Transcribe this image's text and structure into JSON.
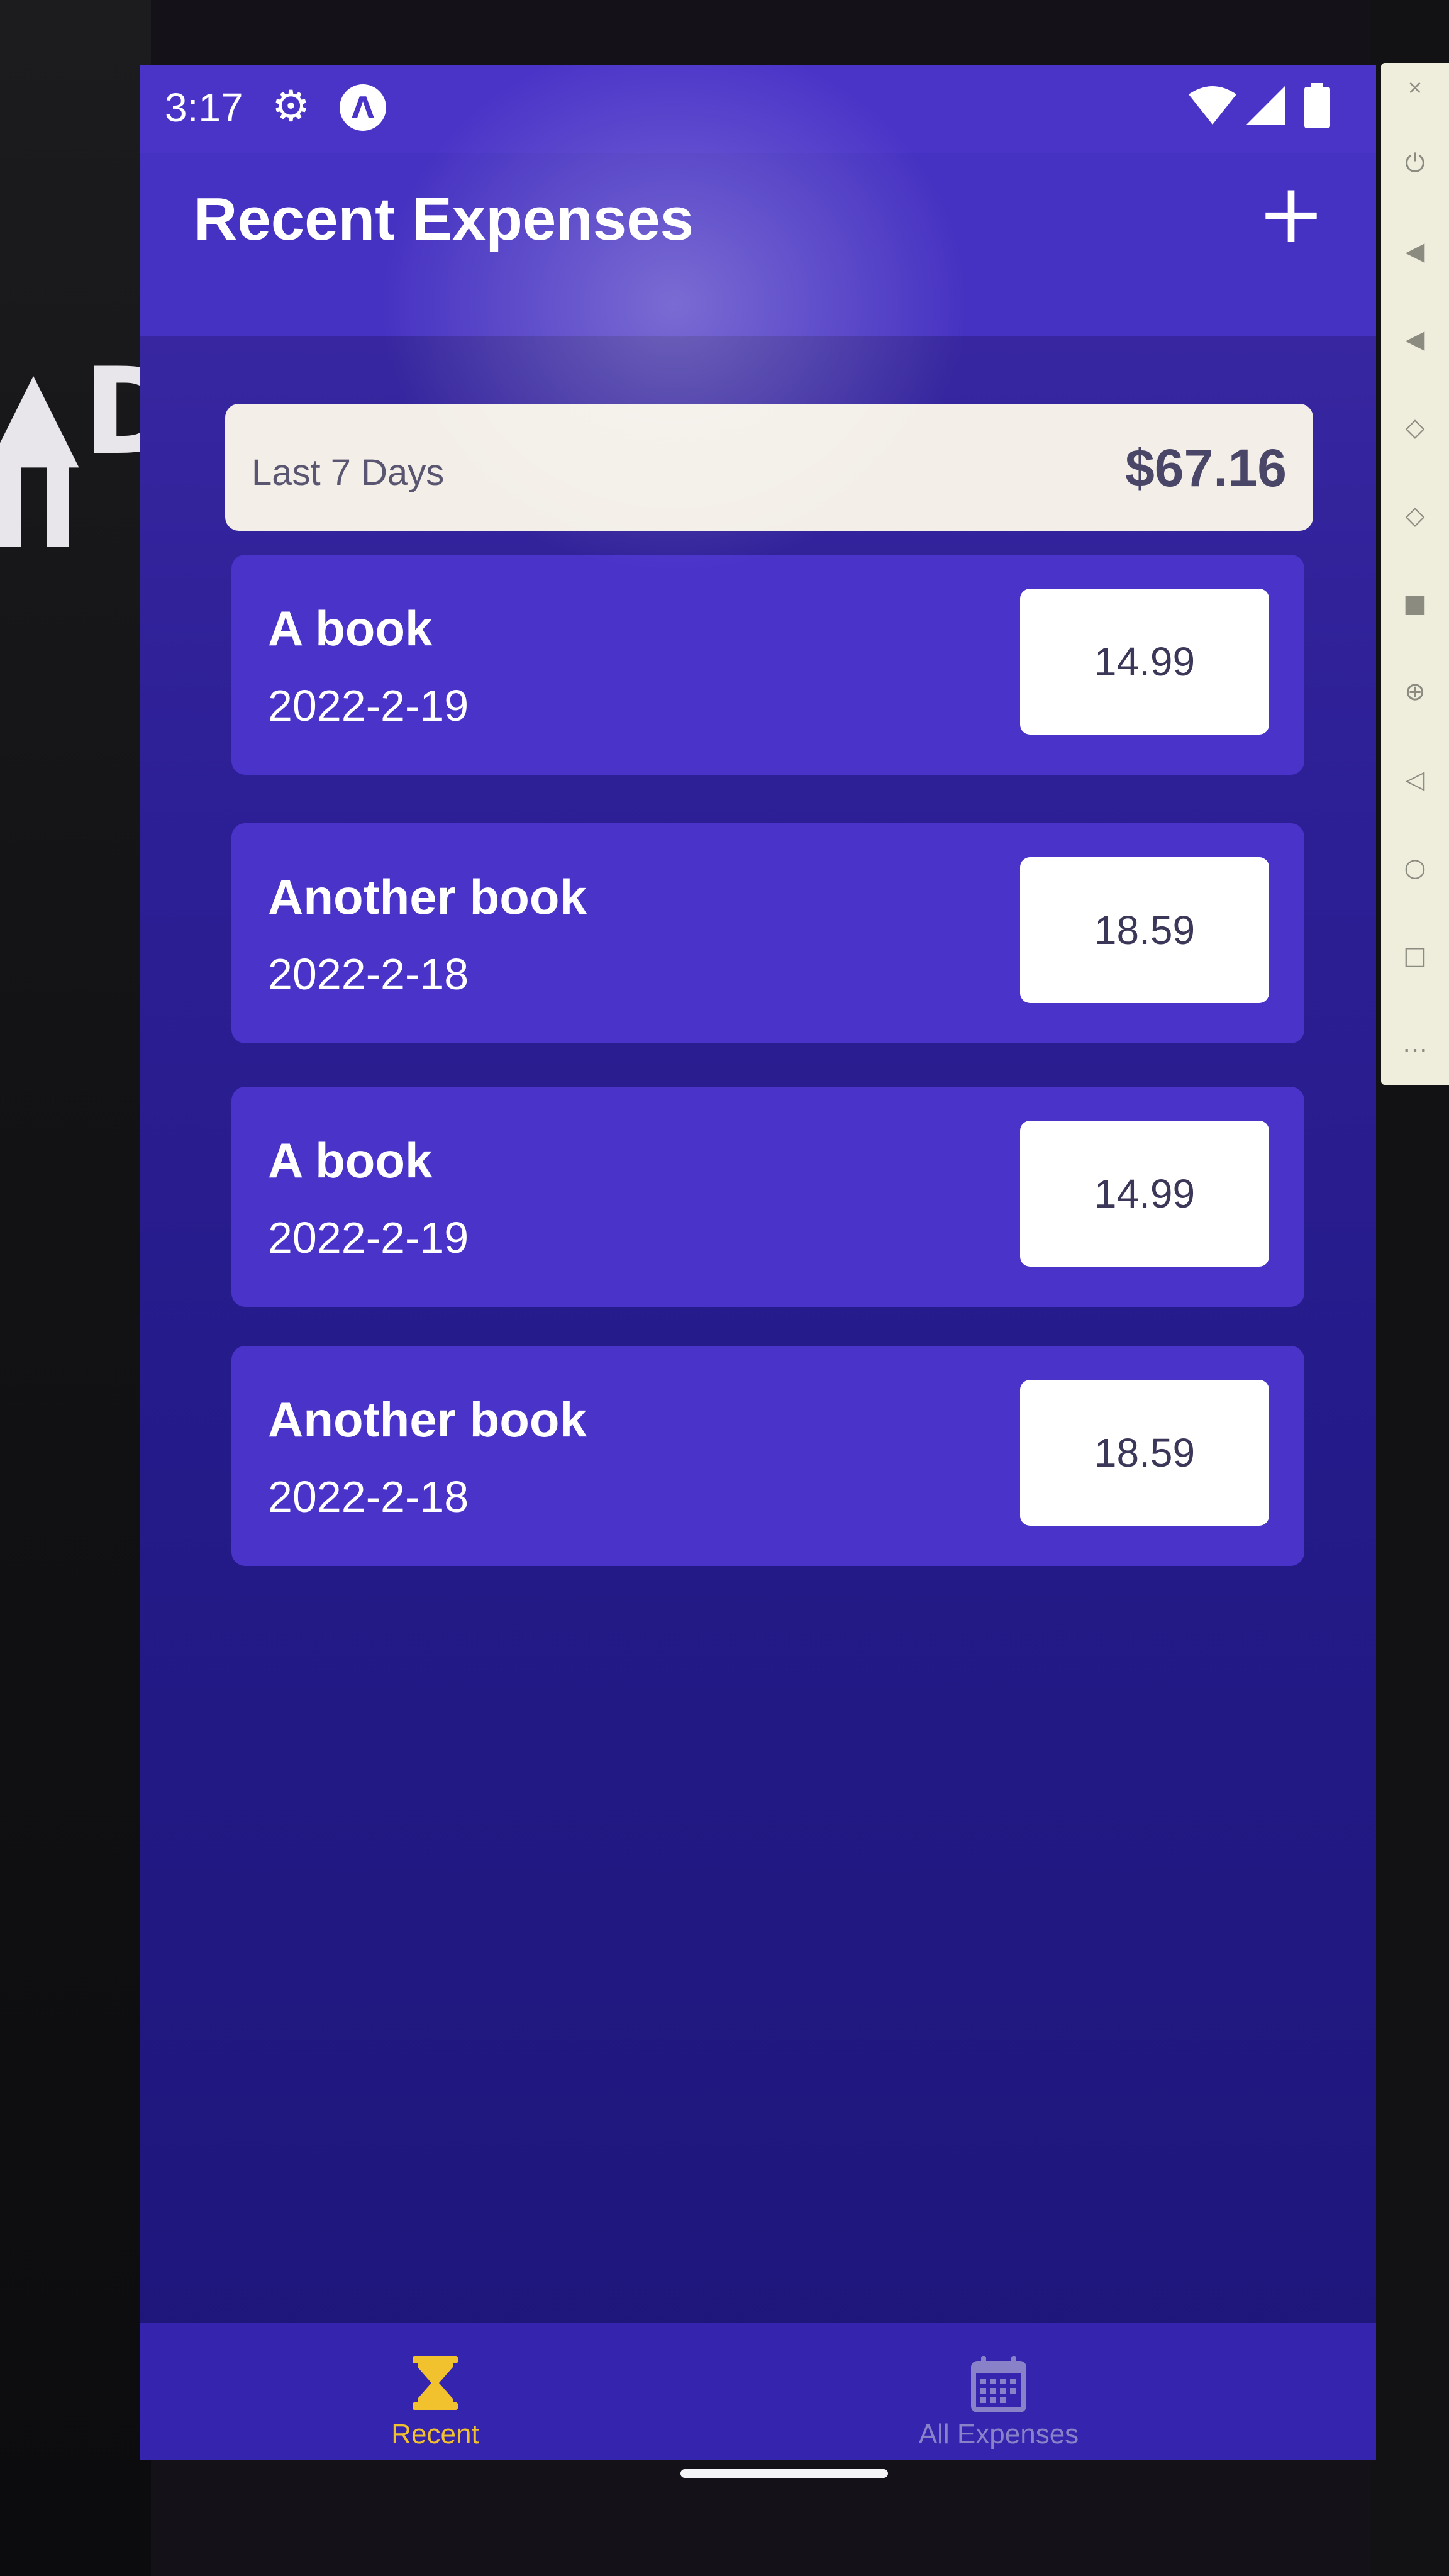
{
  "status_bar": {
    "time": "3:17",
    "settings_icon": "gear-icon",
    "app_icon": "Λ",
    "wifi_icon": "wifi-icon",
    "signal_icon": "signal-icon",
    "battery_icon": "battery-icon"
  },
  "header": {
    "title": "Recent Expenses",
    "add_label": "+"
  },
  "summary": {
    "period": "Last 7 Days",
    "sum": "$67.16"
  },
  "expenses": [
    {
      "description": "A book",
      "date": "2022-2-19",
      "amount": "14.99"
    },
    {
      "description": "Another book",
      "date": "2022-2-18",
      "amount": "18.59"
    },
    {
      "description": "A book",
      "date": "2022-2-19",
      "amount": "14.99"
    },
    {
      "description": "Another book",
      "date": "2022-2-18",
      "amount": "18.59"
    }
  ],
  "tabs": [
    {
      "label": "Recent",
      "icon": "hourglass-icon",
      "active": true,
      "color": "#f2c12e"
    },
    {
      "label": "All Expenses",
      "icon": "calendar-icon",
      "active": false,
      "color": "#8a82c8"
    }
  ],
  "colors": {
    "primary": "#4632c2",
    "background": "#241a88",
    "accent": "#f2c12e",
    "card": "#4933c9"
  }
}
